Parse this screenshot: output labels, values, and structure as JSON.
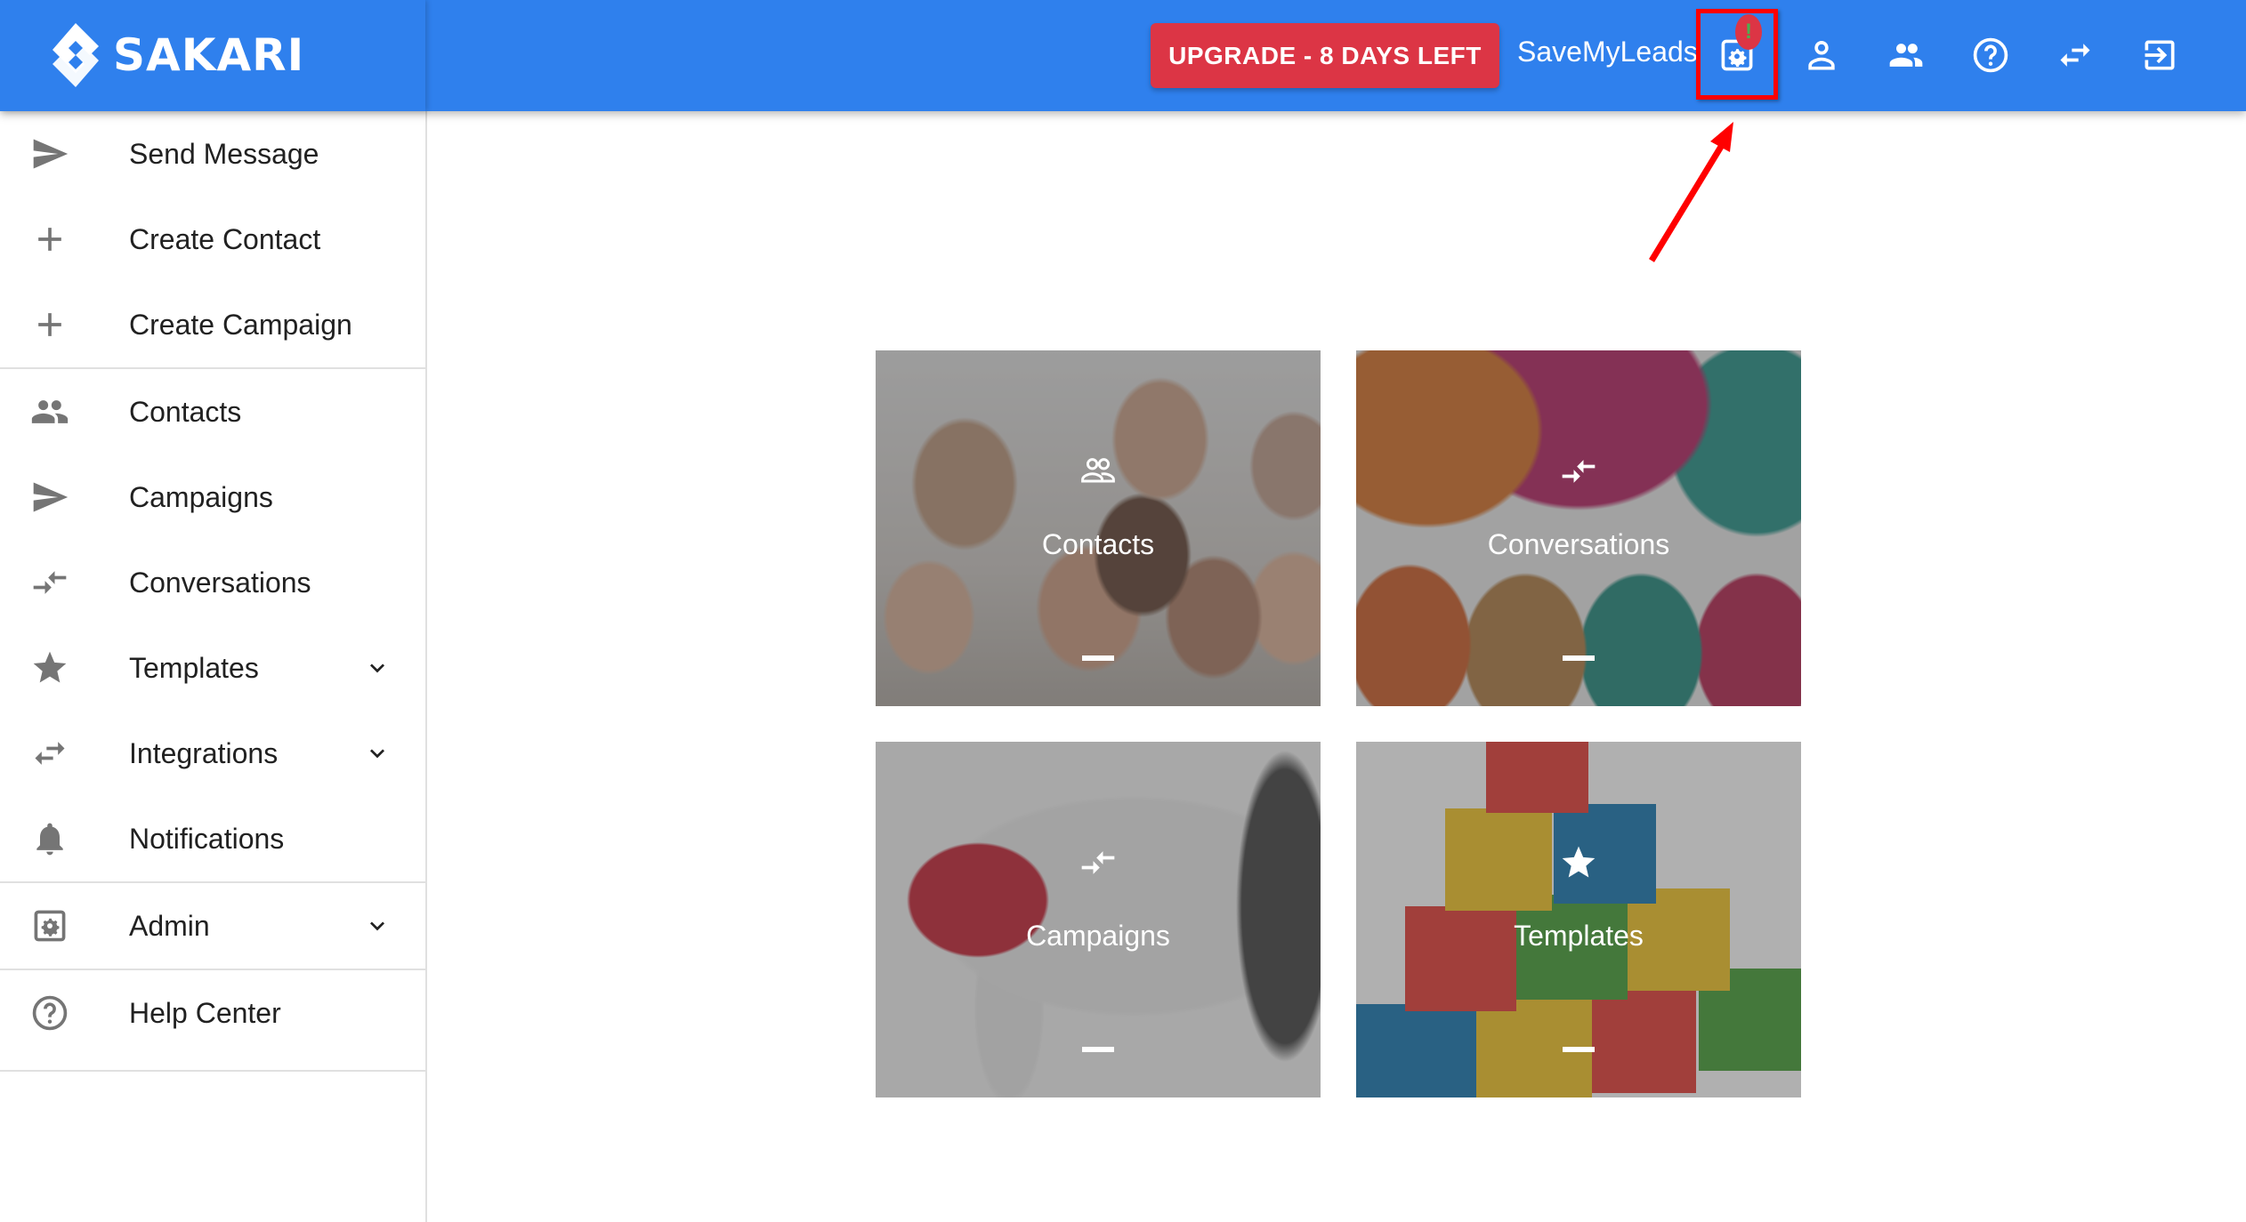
{
  "brand": {
    "name": "SAKARI",
    "header_color": "#2f80ed"
  },
  "header": {
    "upgrade_button": "UPGRADE - 8 DAYS LEFT",
    "upgrade_color": "#dc3545",
    "account_name": "SaveMyLeads",
    "badge_text": "!",
    "icons": [
      "admin-settings-icon",
      "profile-icon",
      "users-icon",
      "help-icon",
      "switch-account-icon",
      "logout-icon"
    ]
  },
  "sidebar": {
    "groups": [
      {
        "items": [
          {
            "label": "Send Message",
            "icon": "send-icon"
          },
          {
            "label": "Create Contact",
            "icon": "plus-icon"
          },
          {
            "label": "Create Campaign",
            "icon": "plus-icon"
          }
        ]
      },
      {
        "items": [
          {
            "label": "Contacts",
            "icon": "people-icon"
          },
          {
            "label": "Campaigns",
            "icon": "send-icon"
          },
          {
            "label": "Conversations",
            "icon": "compare-arrows-icon"
          },
          {
            "label": "Templates",
            "icon": "star-icon",
            "expandable": true
          },
          {
            "label": "Integrations",
            "icon": "swap-icon",
            "expandable": true
          },
          {
            "label": "Notifications",
            "icon": "bell-icon"
          }
        ]
      },
      {
        "items": [
          {
            "label": "Admin",
            "icon": "admin-settings-icon",
            "expandable": true
          }
        ]
      },
      {
        "items": [
          {
            "label": "Help Center",
            "icon": "help-icon"
          }
        ]
      }
    ]
  },
  "cards": [
    {
      "title": "Contacts",
      "icon": "people-outline-icon"
    },
    {
      "title": "Conversations",
      "icon": "compare-arrows-icon"
    },
    {
      "title": "Campaigns",
      "icon": "compare-arrows-icon"
    },
    {
      "title": "Templates",
      "icon": "star-icon"
    }
  ]
}
